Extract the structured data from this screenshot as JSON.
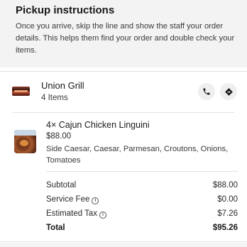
{
  "pickup": {
    "title": "Pickup instructions",
    "description": "Once you arrive, skip the line and show the staff your order details. This helps them find your order and double check your items."
  },
  "store": {
    "name": "Union Grill",
    "item_count": "4 Items",
    "logo_icon": "restaurant-logo",
    "phone_icon": "phone-icon",
    "directions_icon": "directions-icon"
  },
  "item": {
    "name": "4× Cajun Chicken Linguini",
    "price": "$88.00",
    "modifiers": "Side Caesar, Caesar, Parmesan, Croutons, Onions, Tomatoes"
  },
  "totals": {
    "subtotal_label": "Subtotal",
    "subtotal_value": "$88.00",
    "service_fee_label": "Service Fee",
    "service_fee_value": "$0.00",
    "tax_label": "Estimated Tax",
    "tax_value": "$7.26",
    "total_label": "Total",
    "total_value": "$95.26",
    "info_icon": "info-icon"
  },
  "colors": {
    "panel_gray": "#f3f3f3",
    "text_primary": "#1a1a1a",
    "button_bg": "#efefef"
  }
}
